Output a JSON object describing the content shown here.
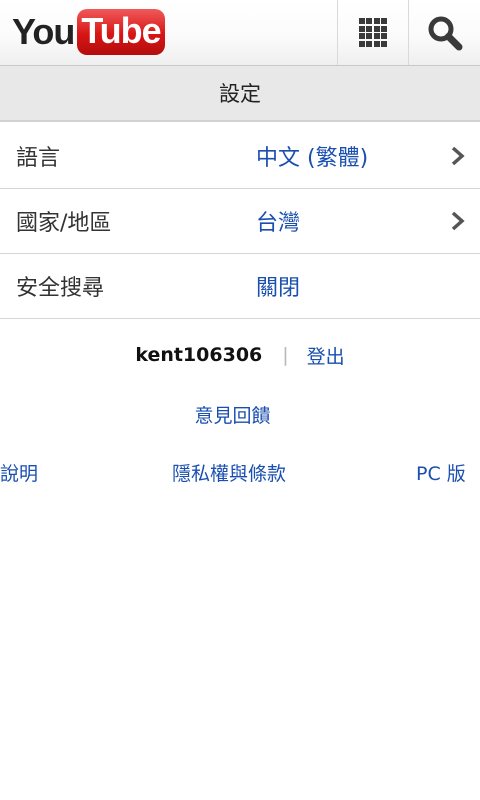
{
  "header": {
    "logo_you": "You",
    "logo_tube": "Tube",
    "logo_colors": {
      "text": "#222222",
      "tube_bg": "#d81515",
      "tube_text": "#ffffff"
    },
    "icons": [
      "grid-icon",
      "search-icon"
    ]
  },
  "title": "設定",
  "settings": [
    {
      "label": "語言",
      "value": "中文 (繁體)",
      "chevron": true
    },
    {
      "label": "國家/地區",
      "value": "台灣",
      "chevron": true
    },
    {
      "label": "安全搜尋",
      "value": "關閉",
      "chevron": false
    }
  ],
  "account": {
    "username": "kent106306",
    "separator": "|",
    "sign_out": "登出"
  },
  "footer": {
    "feedback": "意見回饋",
    "help": "說明",
    "privacy_terms": "隱私權與條款",
    "desktop": "PC 版"
  },
  "colors": {
    "link": "#1a4fb0",
    "title_bar_bg": "#e8e8e8"
  }
}
